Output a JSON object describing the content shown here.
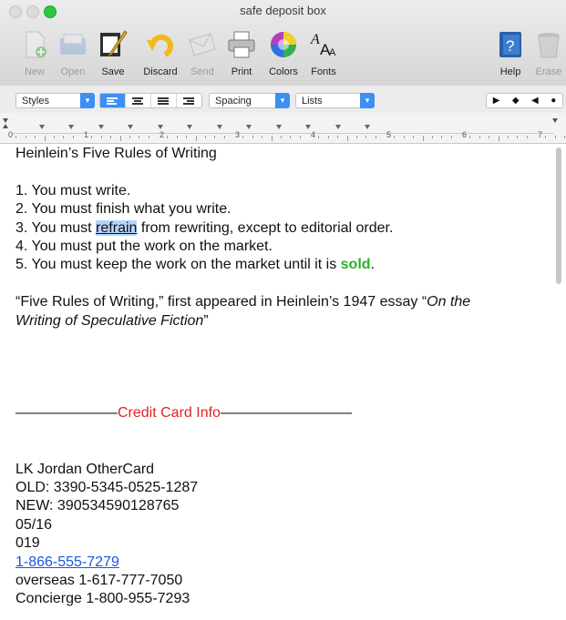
{
  "window": {
    "title": "safe deposit box"
  },
  "toolbar": {
    "new": "New",
    "open": "Open",
    "save": "Save",
    "discard": "Discard",
    "send": "Send",
    "print": "Print",
    "colors": "Colors",
    "fonts": "Fonts",
    "help": "Help",
    "erase": "Erase"
  },
  "formatbar": {
    "styles": "Styles",
    "spacing": "Spacing",
    "lists": "Lists"
  },
  "ruler": {
    "marks": [
      "0",
      "1",
      "2",
      "3",
      "4",
      "5",
      "6",
      "7"
    ]
  },
  "document": {
    "heading": "Heinlein’s Five Rules of Writing",
    "rule1": "1. You must write.",
    "rule2": "2. You must finish what you write.",
    "rule3_a": "3. You must ",
    "rule3_sel": "refrain",
    "rule3_b": " from rewriting, except to editorial order.",
    "rule4": "4. You must put the work on the market.",
    "rule5_a": "5. You must keep the work on the market until it is ",
    "rule5_sold": "sold",
    "rule5_b": ".",
    "quote_a": "“Five Rules of Writing,” first appeared in Heinlein’s 1947 essay “",
    "quote_italic1": "On the",
    "quote_italic2": "Writing of Speculative Fiction",
    "quote_end": "”",
    "dashes_left": "———————",
    "cc_title": "Credit Card Info",
    "dashes_right": "—————————",
    "cc_name": "LK Jordan  OtherCard",
    "cc_old": "OLD: 3390-5345-0525-1287",
    "cc_new": "NEW: 390534590128765",
    "cc_exp": "05/16",
    "cc_code": "019",
    "cc_phone": "1-866-555-7279",
    "cc_overseas": "overseas 1-617-777-7050",
    "cc_concierge": "Concierge 1-800-955-7293"
  }
}
